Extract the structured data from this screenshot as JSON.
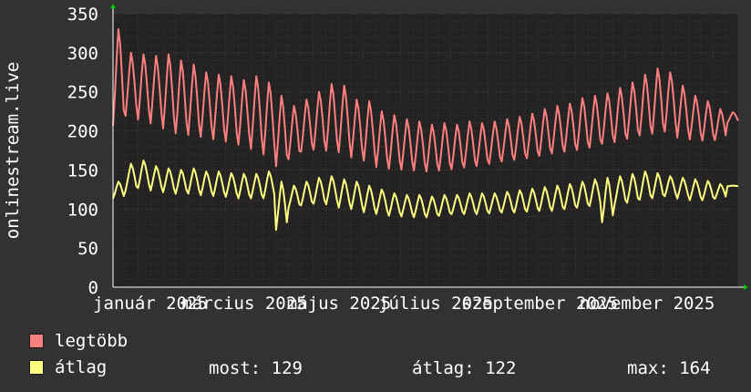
{
  "chart_data": {
    "type": "line",
    "ylabel": "onlinestream.live",
    "ylim": [
      0,
      350
    ],
    "yticks": [
      0,
      50,
      100,
      150,
      200,
      250,
      300,
      350
    ],
    "xtick_labels": [
      "január 2025",
      "március 2025",
      "május 2025",
      "július 2025",
      "szeptember 2025",
      "november 2025"
    ],
    "grid": true,
    "colors": {
      "background": "#323232",
      "plot_background": "#232323",
      "grid": "#5a3a3a",
      "axis": "#ffffff"
    },
    "series": [
      {
        "name": "legtöbb",
        "color": "#ff7f7f",
        "weekly_peaks": [
          330,
          300,
          298,
          296,
          298,
          290,
          285,
          275,
          272,
          270,
          265,
          270,
          262,
          245,
          232,
          240,
          250,
          260,
          258,
          240,
          238,
          225,
          220,
          215,
          212,
          208,
          210,
          208,
          212,
          210,
          212,
          215,
          218,
          222,
          228,
          232,
          235,
          242,
          245,
          248,
          255,
          262,
          272,
          280,
          275,
          258,
          245,
          238,
          228,
          224
        ],
        "weekly_troughs": [
          200,
          215,
          210,
          205,
          198,
          192,
          190,
          188,
          185,
          182,
          178,
          172,
          165,
          150,
          160,
          170,
          172,
          170,
          168,
          162,
          158,
          150,
          148,
          147,
          146,
          145,
          146,
          148,
          150,
          152,
          155,
          158,
          160,
          162,
          165,
          168,
          170,
          172,
          175,
          180,
          182,
          186,
          190,
          192,
          195,
          188,
          186,
          185,
          186,
          210
        ]
      },
      {
        "name": "átlag",
        "color": "#ffff7f",
        "weekly_peaks": [
          135,
          158,
          162,
          155,
          152,
          150,
          152,
          148,
          148,
          146,
          145,
          145,
          148,
          135,
          130,
          135,
          140,
          142,
          138,
          135,
          130,
          125,
          120,
          118,
          118,
          116,
          118,
          118,
          120,
          120,
          120,
          122,
          124,
          126,
          128,
          130,
          132,
          135,
          138,
          140,
          142,
          145,
          148,
          146,
          142,
          140,
          138,
          136,
          132,
          130
        ],
        "weekly_troughs": [
          112,
          122,
          125,
          122,
          120,
          118,
          118,
          116,
          115,
          114,
          112,
          112,
          112,
          70,
          100,
          103,
          105,
          104,
          100,
          98,
          94,
          92,
          90,
          89,
          88,
          88,
          90,
          92,
          92,
          92,
          93,
          94,
          94,
          95,
          96,
          96,
          98,
          100,
          102,
          80,
          104,
          106,
          110,
          112,
          115,
          112,
          110,
          110,
          112,
          129
        ]
      }
    ],
    "legend": [
      {
        "label": "legtöbb",
        "color": "#ff7f7f"
      },
      {
        "label": "átlag",
        "color": "#ffff7f"
      }
    ],
    "stats": {
      "most": "most: 129",
      "atlag": "átlag: 122",
      "max": "max: 164"
    }
  }
}
